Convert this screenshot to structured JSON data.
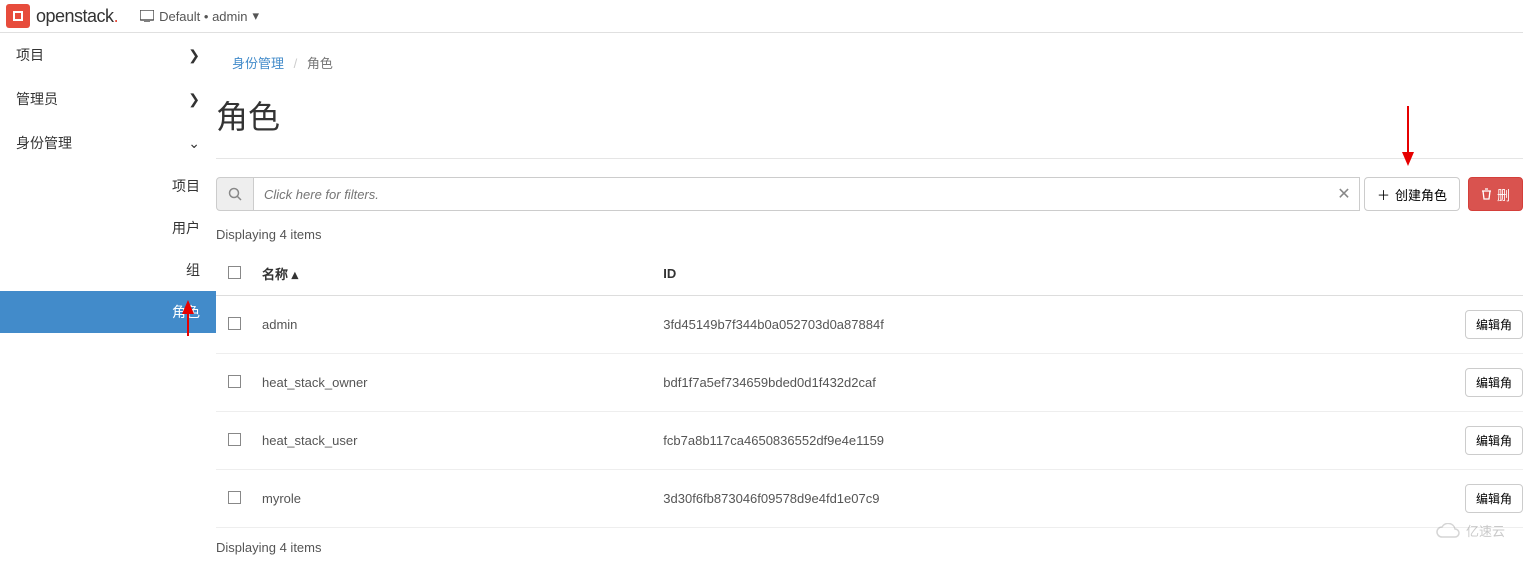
{
  "topbar": {
    "brand": "openstack",
    "project_prefix": "Default",
    "project_user": "admin"
  },
  "sidebar": {
    "items": [
      {
        "label": "项目",
        "expanded": false
      },
      {
        "label": "管理员",
        "expanded": false
      },
      {
        "label": "身份管理",
        "expanded": true
      }
    ],
    "sub": [
      {
        "label": "项目"
      },
      {
        "label": "用户"
      },
      {
        "label": "组"
      },
      {
        "label": "角色"
      }
    ]
  },
  "breadcrumb": {
    "parent": "身份管理",
    "current": "角色"
  },
  "page": {
    "title": "角色"
  },
  "toolbar": {
    "search_placeholder": "Click here for filters.",
    "create_label": "创建角色",
    "delete_label": "删"
  },
  "table": {
    "count_text_top": "Displaying 4 items",
    "count_text_bottom": "Displaying 4 items",
    "headers": {
      "name": "名称",
      "id": "ID"
    },
    "row_action": "编辑角",
    "rows": [
      {
        "name": "admin",
        "id": "3fd45149b7f344b0a052703d0a87884f"
      },
      {
        "name": "heat_stack_owner",
        "id": "bdf1f7a5ef734659bded0d1f432d2caf"
      },
      {
        "name": "heat_stack_user",
        "id": "fcb7a8b117ca4650836552df9e4e1159"
      },
      {
        "name": "myrole",
        "id": "3d30f6fb873046f09578d9e4fd1e07c9"
      }
    ]
  },
  "watermark": {
    "text": "亿速云"
  }
}
